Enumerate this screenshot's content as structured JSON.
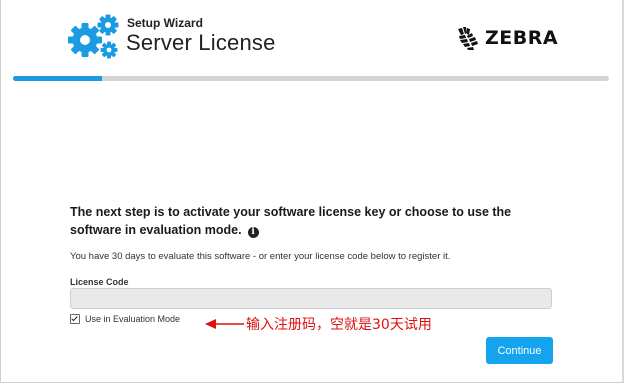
{
  "header": {
    "subtitle": "Setup Wizard",
    "title": "Server License",
    "logo_icon": "gears-icon",
    "brand": {
      "name": "ZEBRA",
      "icon": "zebra-head-icon"
    },
    "accent_color": "#1a9be2"
  },
  "progress": {
    "value": 0.15
  },
  "main": {
    "heading": "The next step is to activate your software license key or choose to use the software in evaluation mode.",
    "info_icon": "info-icon",
    "description": "You have 30 days to evaluate this software - or enter your license code below to register it.",
    "license_label": "License Code",
    "license_value": "",
    "evaluation_checkbox": {
      "label": "Use in Evaluation Mode",
      "checked": true
    },
    "annotation": {
      "text": "输入注册码，空就是30天试用",
      "color": "#e01010"
    },
    "continue_label": "Continue",
    "button_color": "#13a3ef"
  }
}
